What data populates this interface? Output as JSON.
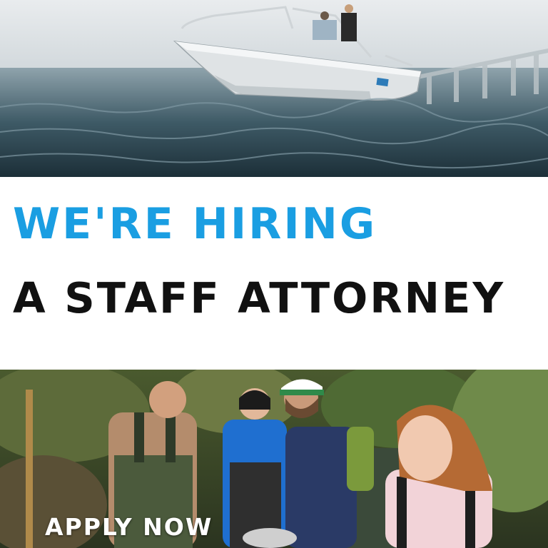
{
  "theme": {
    "accent": "#1a9ee2",
    "ink": "#111111"
  },
  "headline": {
    "line1": "WE'RE HIRING",
    "line2": "A STAFF ATTORNEY"
  },
  "cta": {
    "label": "APPLY NOW"
  }
}
